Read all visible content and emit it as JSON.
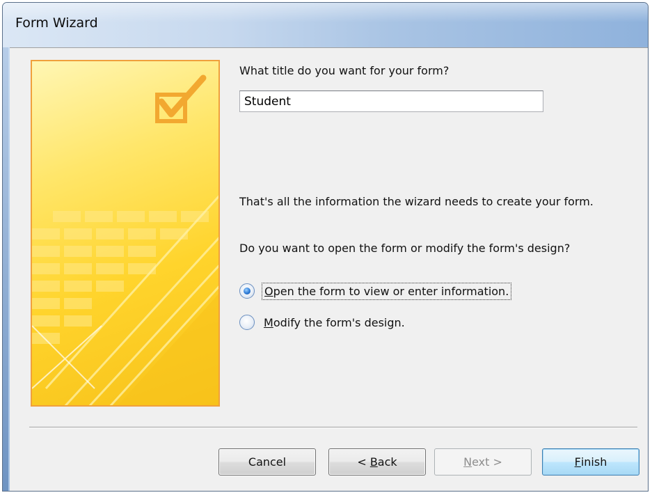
{
  "window": {
    "title": "Form Wizard"
  },
  "wizard": {
    "title_prompt": "What title do you want for your form?",
    "title_value": "Student",
    "info_text": "That's all the information the wizard needs to create your form.",
    "question": "Do you want to open the form or modify the form's design?",
    "options": [
      {
        "label": "Open the form to view or enter information.",
        "mnemonic": "O",
        "rest": "pen the form to view or enter information.",
        "selected": true
      },
      {
        "label": "Modify the form's design.",
        "mnemonic": "M",
        "rest": "odify the form's design.",
        "selected": false
      }
    ]
  },
  "buttons": {
    "cancel": "Cancel",
    "back_prefix": "< ",
    "back_mnemonic": "B",
    "back_rest": "ack",
    "next_mnemonic": "N",
    "next_rest": "ext >",
    "finish_mnemonic": "F",
    "finish_rest": "inish"
  },
  "colors": {
    "accent": "#2d7ad6",
    "art_border": "#f0a03c",
    "art_yellow": "#ffd42c"
  },
  "icons": {
    "art": "checkbox-check-art"
  }
}
